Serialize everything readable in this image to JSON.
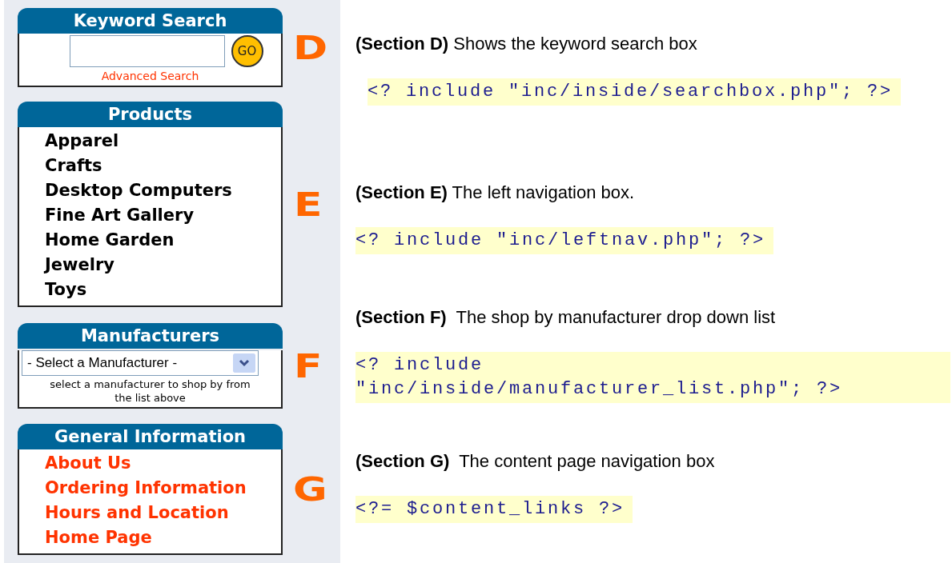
{
  "sidebar": {
    "boxes": [
      {
        "kind": "search",
        "title": "Keyword Search",
        "go_label": "GO",
        "advanced_link": "Advanced Search",
        "letter": "D"
      },
      {
        "kind": "list",
        "title": "Products",
        "items": [
          "Apparel",
          "Crafts",
          "Desktop Computers",
          "Fine Art Gallery",
          "Home Garden",
          "Jewelry",
          "Toys"
        ],
        "letter": "E"
      },
      {
        "kind": "select",
        "title": "Manufacturers",
        "select_value": "- Select a Manufacturer -",
        "hint": "select a manufacturer to shop by from the list above",
        "letter": "F"
      },
      {
        "kind": "links",
        "title": "General Information",
        "items": [
          "About Us",
          "Ordering Information",
          "Hours and Location",
          "Home Page"
        ],
        "letter": "G"
      }
    ]
  },
  "notes": [
    {
      "text": "**(Section D)** Shows the keyword search box",
      "code": "<? include \"inc/inside/searchbox.php\"; ?>"
    },
    {
      "text": "**(Section E)** The left navigation box.",
      "code": "<? include \"inc/leftnav.php\"; ?>"
    },
    {
      "text": "**(Section F)**  The shop by manufacturer drop down list",
      "code": "<? include \"inc/inside/manufacturer_list.php\"; ?>"
    },
    {
      "text": "**(Section G)**  The content page navigation box",
      "code": "<?= $content_links ?>"
    }
  ]
}
